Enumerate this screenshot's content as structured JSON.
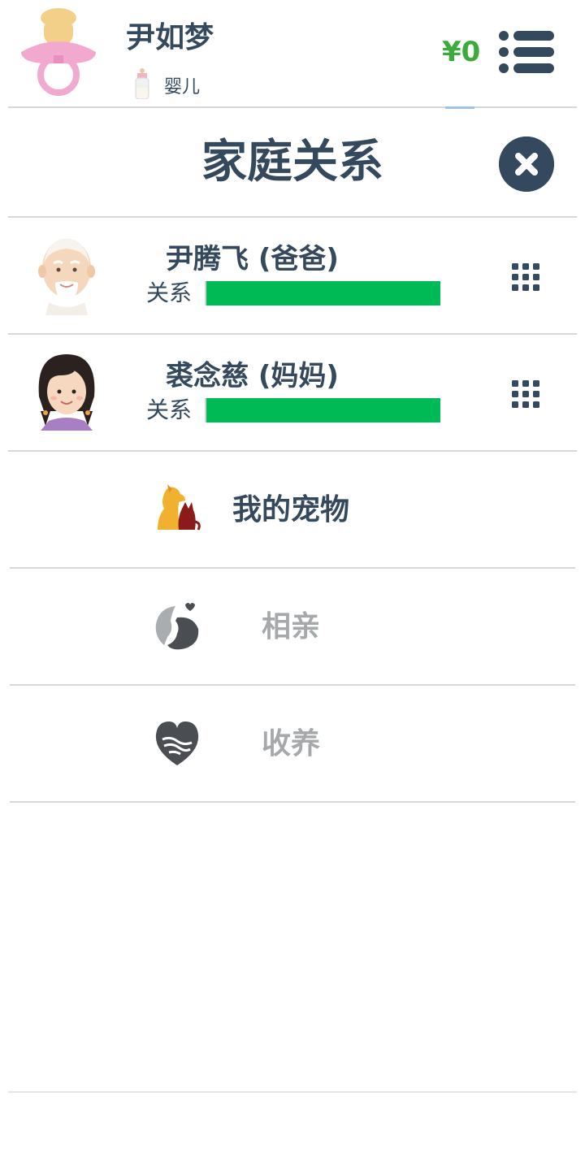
{
  "header": {
    "player_name": "尹如梦",
    "life_stage": "婴儿",
    "money": "¥0"
  },
  "panel": {
    "title": "家庭关系"
  },
  "family": [
    {
      "name": "尹腾飞 (爸爸)",
      "relation_label": "关系",
      "relation_level": 1.0
    },
    {
      "name": "裘念慈 (妈妈)",
      "relation_label": "关系",
      "relation_level": 1.0
    }
  ],
  "actions": [
    {
      "label": "我的宠物",
      "icon": "pet-icon",
      "enabled": true
    },
    {
      "label": "相亲",
      "icon": "dating-icon",
      "enabled": false
    },
    {
      "label": "收养",
      "icon": "adopt-icon",
      "enabled": false
    }
  ],
  "colors": {
    "text": "#34495e",
    "money": "#3bab3b",
    "relation_bar": "#00bb55",
    "disabled_text": "#a5a9ac"
  }
}
